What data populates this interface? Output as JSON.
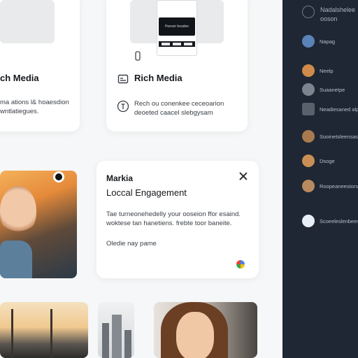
{
  "cards": {
    "rich_left": {
      "title": "ch Media",
      "body": "ma ations l& hoaesdion wntlatiegues."
    },
    "rich_right": {
      "title": "Rich Media",
      "body": "Rech ou conenkee ceceoarion deoeted caacel slebgysam"
    },
    "engagement": {
      "eyebrow": "Markia",
      "title": "Loccal Engagement",
      "body": "Tae turneonehedelly your ooseion ffor esaind. woktese tan hanetiens. frebte toor baneite.",
      "footer": "Oledie nay pame"
    },
    "phone_preview": {
      "screen_label": "Hoeser beadee"
    }
  },
  "sidebar": {
    "header": {
      "line1": "Nadalshelee",
      "line2": "ooson"
    },
    "items": [
      {
        "label": "Napag",
        "icon": "avatar-blue",
        "color": "#5a83b8"
      },
      {
        "label": "Neelp",
        "icon": "avatar-orange",
        "color": "#d08a4a"
      },
      {
        "label": "Suaanetpe",
        "icon": "avatar-gray",
        "color": "#7c858f"
      },
      {
        "label": "Neadiesaned alpos",
        "icon": "image-icon",
        "color": "#58616c"
      },
      {
        "label": "Sooinetsleensasiur",
        "icon": "avatar-brown",
        "color": "#a87a4f"
      },
      {
        "label": "Dsoge",
        "icon": "avatar-amber",
        "color": "#c98f55"
      },
      {
        "label": "Roopeaneestorsanan",
        "icon": "avatar-tan",
        "color": "#b98960"
      },
      {
        "label": "Scoeeleslenbeesess",
        "icon": "cloud-icon",
        "color": "#e8eef5"
      }
    ]
  }
}
